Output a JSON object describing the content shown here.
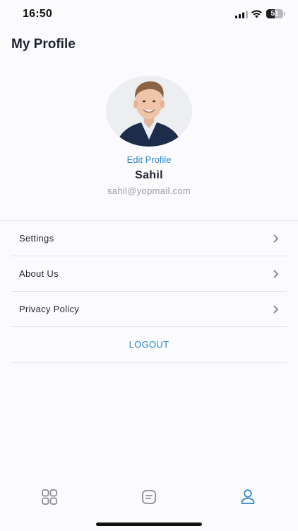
{
  "status_bar": {
    "time": "16:50",
    "battery_level": "51",
    "battery_fraction": 0.51
  },
  "header": {
    "title": "My Profile"
  },
  "profile": {
    "edit_label": "Edit Profile",
    "name": "Sahil",
    "email": "sahil@yopmail.com"
  },
  "menu": {
    "items": [
      {
        "label": "Settings",
        "icon": "chevron-right-icon"
      },
      {
        "label": "About Us",
        "icon": "chevron-right-icon"
      },
      {
        "label": "Privacy Policy",
        "icon": "chevron-right-icon"
      }
    ],
    "logout_label": "LOGOUT"
  },
  "tab_bar": {
    "tabs": [
      {
        "icon": "grid-icon",
        "active": false
      },
      {
        "icon": "list-icon",
        "active": false
      },
      {
        "icon": "user-icon",
        "active": true
      }
    ]
  },
  "colors": {
    "accent": "#2c88c7",
    "text": "#1f2430",
    "muted": "#9a9ea6",
    "inactive_icon": "#8a8d93"
  }
}
